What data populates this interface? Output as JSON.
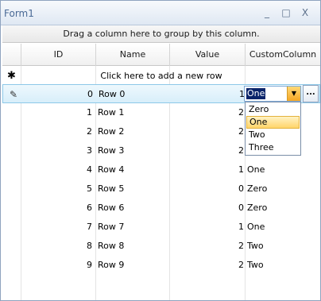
{
  "window": {
    "title": "Form1",
    "minimize_glyph": "_",
    "maximize_glyph": "□",
    "close_glyph": "X"
  },
  "grid": {
    "group_panel_text": "Drag a column here to group by this column.",
    "columns": [
      "ID",
      "Name",
      "Value",
      "CustomColumn"
    ],
    "new_row_text": "Click here to add a new row",
    "rows": [
      {
        "id": "0",
        "name": "Row 0",
        "value": "1",
        "custom": ""
      },
      {
        "id": "1",
        "name": "Row 1",
        "value": "2",
        "custom": ""
      },
      {
        "id": "2",
        "name": "Row 2",
        "value": "2",
        "custom": ""
      },
      {
        "id": "3",
        "name": "Row 3",
        "value": "2",
        "custom": ""
      },
      {
        "id": "4",
        "name": "Row 4",
        "value": "1",
        "custom": "One"
      },
      {
        "id": "5",
        "name": "Row 5",
        "value": "0",
        "custom": "Zero"
      },
      {
        "id": "6",
        "name": "Row 6",
        "value": "0",
        "custom": "Zero"
      },
      {
        "id": "7",
        "name": "Row 7",
        "value": "1",
        "custom": "One"
      },
      {
        "id": "8",
        "name": "Row 8",
        "value": "2",
        "custom": "Two"
      },
      {
        "id": "9",
        "name": "Row 9",
        "value": "2",
        "custom": "Two"
      }
    ],
    "editor": {
      "selected_value": "One",
      "options": [
        "Zero",
        "One",
        "Two",
        "Three"
      ],
      "highlighted_option": "One",
      "ellipsis_label": "..."
    }
  },
  "icons": {
    "new_row": "asterisk-icon",
    "edit_row": "pencil-icon",
    "dropdown": "chevron-down-icon"
  },
  "colors": {
    "title_text": "#4a6a96",
    "active_row": "#d8eefa",
    "selection": "#0a246a",
    "dropdown_button": "#f5a623",
    "highlight_option": "#ffd56a"
  }
}
